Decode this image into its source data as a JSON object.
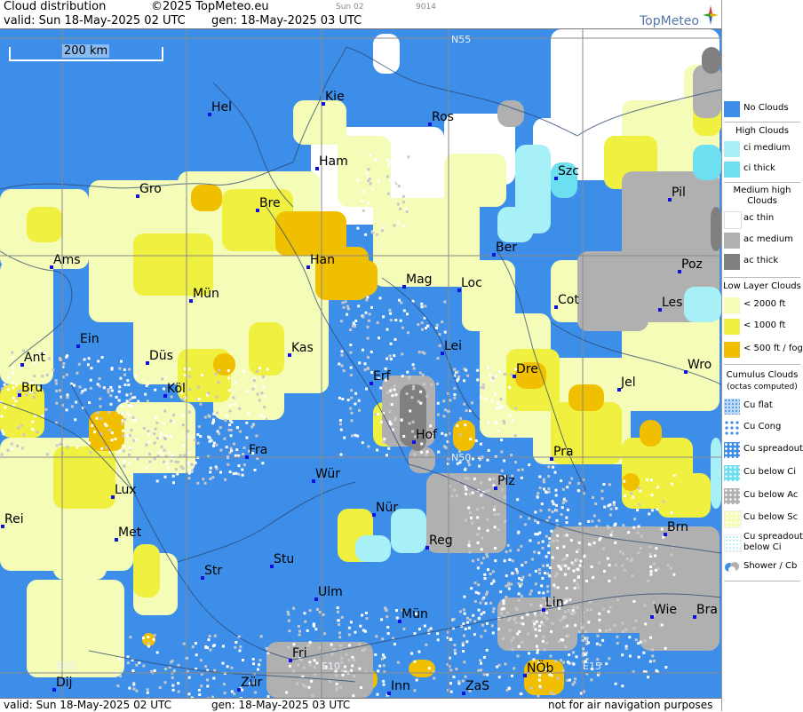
{
  "header": {
    "title": "Cloud distribution",
    "copyright": "©2025 TopMeteo.eu",
    "tag": "Sun 02",
    "code": "9014",
    "valid": "valid:  Sun  18-May-2025  02 UTC",
    "gen": "gen: 18-May-2025 03 UTC"
  },
  "footer": {
    "valid": "valid:  Sun  18-May-2025  02 UTC",
    "gen": "gen: 18-May-2025 03 UTC",
    "note": "not for air navigation purposes"
  },
  "logo": {
    "text": "TopMeteo"
  },
  "map": {
    "scale_label": "200 km",
    "grid_labels": [
      "N55",
      "N50",
      "E05",
      "E10",
      "E15"
    ],
    "cities": [
      "Hel",
      "Kie",
      "Ros",
      "Ham",
      "Szc",
      "Gro",
      "Bre",
      "Pil",
      "Ber",
      "Ams",
      "Han",
      "Mag",
      "Loc",
      "Poz",
      "Mün",
      "Cot",
      "Les",
      "Ein",
      "Kas",
      "Lei",
      "Ant",
      "Düs",
      "Dre",
      "Wro",
      "Erf",
      "Bru",
      "Köl",
      "Jel",
      "Hof",
      "Fra",
      "Pra",
      "Wür",
      "Plz",
      "Lux",
      "Nür",
      "Rei",
      "Met",
      "Brn",
      "Reg",
      "Stu",
      "Str",
      "Ulm",
      "Lin",
      "Mün",
      "Wie",
      "Bra",
      "Fri",
      "Dij",
      "Zür",
      "Inn",
      "ZaS",
      "NÖb"
    ]
  },
  "legend": {
    "no_clouds": "No Clouds",
    "high_head": "High Clouds",
    "ci_medium": "ci medium",
    "ci_thick": "ci thick",
    "mid_head1": "Medium high",
    "mid_head2": "Clouds",
    "ac_thin": "ac thin",
    "ac_medium": "ac medium",
    "ac_thick": "ac thick",
    "low_head": "Low Layer Clouds",
    "low_2000": "< 2000 ft",
    "low_1000": "< 1000 ft",
    "low_500": "< 500 ft / fog",
    "cu_head1": "Cumulus Clouds",
    "cu_head2": "(octas computed)",
    "cu_flat": "Cu flat",
    "cu_cong": "Cu Cong",
    "cu_spread": "Cu spreadout",
    "cu_below_ci": "Cu below Ci",
    "cu_below_ac": "Cu below Ac",
    "cu_below_sc": "Cu below Sc",
    "cu_spread_ci1": "Cu spreadout",
    "cu_spread_ci2": "below Ci",
    "shower": "Shower / Cb"
  },
  "colors": {
    "no_clouds": "#3d8ee8",
    "ci_medium": "#a8f0f8",
    "ci_thick": "#6ce0f0",
    "ac_thin": "#ffffff",
    "ac_medium": "#b0b0b0",
    "ac_thick": "#808080",
    "low_2000": "#f4fcb8",
    "low_1000": "#f0f040",
    "low_500": "#f0c000"
  }
}
